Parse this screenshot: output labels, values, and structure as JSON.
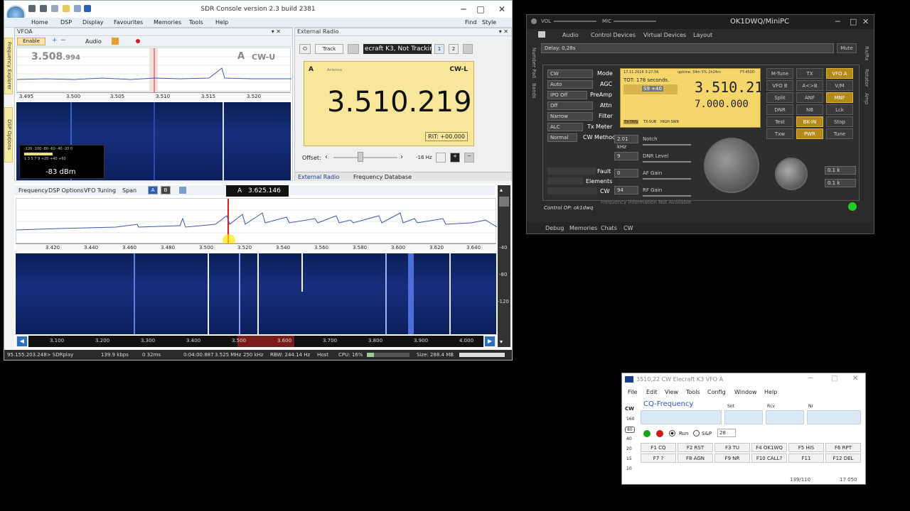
{
  "sdr": {
    "title": "SDR Console version 2.3 build 2381",
    "menu": [
      "Home",
      "DSP",
      "Display",
      "Favourites",
      "Memories",
      "Tools",
      "Help"
    ],
    "menu_right": [
      "Find",
      "Style"
    ],
    "vfo_title": "VFOA",
    "enable": "Enable",
    "audio": "Audio",
    "vfo_freq_main": "3.508",
    "vfo_freq_sub": ".994",
    "vfo_letter": "A",
    "vfo_mode": "CW-U",
    "top_ticks": [
      "3.495",
      "3.500",
      "3.505",
      "3.510",
      "3.515",
      "3.520"
    ],
    "smeter_ticks": "-120 -100 -80 -60 -40 -20 0",
    "smeter_scale": "1  3  5  7  9  +20 +40 +60",
    "smeter_value": "-83 dBm",
    "side_tab_1": "Frequency Explorer",
    "side_tab_2": "DSP Options",
    "ext_title": "External Radio",
    "track": "Track",
    "radio_name": "ecraft K3, Not Trackin",
    "page1": "1",
    "page2": "2",
    "ext_vfo": "A",
    "ext_antenna": "Antenna",
    "ext_mode": "CW-L",
    "ext_freq": "3.510.219",
    "rit": "RIT: +00.000",
    "offset_label": "Offset:",
    "offset_value": "-16 Hz",
    "tab_ext": "External Radio",
    "tab_db": "Frequency Database",
    "lower_menu": [
      "Frequency",
      "DSP Options",
      "VFO Tuning",
      "Span"
    ],
    "vfo_a_btn": "A",
    "vfo_b_btn": "B",
    "vfo_badge_letter": "A",
    "vfo_badge_freq": "3.625.146",
    "main_ticks": [
      "3.420",
      "3.440",
      "3.460",
      "3.480",
      "3.500",
      "3.520",
      "3.540",
      "3.560",
      "3.580",
      "3.600",
      "3.620",
      "3.640"
    ],
    "db_scale": [
      "-40",
      "-80",
      "-120"
    ],
    "bottom_ticks": [
      "3.100",
      "3.200",
      "3.300",
      "3.400",
      "3.500",
      "3.600",
      "3.700",
      "3.800",
      "3.900",
      "4.000"
    ],
    "status": [
      "95.155.203.248> SDRplay",
      "139.9 kbps",
      "0  32ms",
      "0:04:00.887",
      "3.525 MHz",
      "250 kHz",
      "RBW: 244.14 Hz",
      "Host",
      "CPU: 16%",
      "Size: 288.4 MB"
    ]
  },
  "ok": {
    "vol": "VOL",
    "mic": "MIC",
    "title": "OK1DWQ/MiniPC",
    "menu": [
      "Audio",
      "Control Devices",
      "Virtual Devices",
      "Layout"
    ],
    "delay": "Delay: 0,28s",
    "mute": "Mute",
    "left_tabs": [
      "Number Pad",
      "Bands"
    ],
    "right_tabs": [
      "Rx/Rx",
      "Rotator",
      "Amp"
    ],
    "controls": [
      {
        "value": "CW",
        "label": "Mode"
      },
      {
        "value": "Auto",
        "label": "AGC"
      },
      {
        "value": "IPO Off",
        "label": "PreAmp"
      },
      {
        "value": "Off",
        "label": "Attn"
      },
      {
        "value": "Narrow",
        "label": "Filter"
      },
      {
        "value": "ALC",
        "label": "Tx Meter"
      },
      {
        "value": "Normal",
        "label": "CW Method"
      }
    ],
    "lcd_date": "17.11.2016 3:27:56",
    "lcd_uptime": "uptime: 34m 5% 2h24m",
    "lcd_model": "FT-450D",
    "lcd_tot": "TOT: 178 seconds.",
    "lcd_smeter": "S9 +40",
    "lcd_freq_a": "3.510.219",
    "lcd_freq_b": "7.000.000",
    "lcd_flags": [
      "TX-TRIG",
      "TX-SUB",
      "HIGH SWR"
    ],
    "sliders": [
      {
        "value": "2.01 kHz",
        "label": "Notch"
      },
      {
        "value": "9",
        "label": "DNR Level"
      },
      {
        "value": "0",
        "label": "AF Gain"
      },
      {
        "value": "94",
        "label": "RF Gain"
      }
    ],
    "status_labels": [
      "Fault",
      "Elements",
      "CW"
    ],
    "buttons": [
      {
        "label": "M-Tune",
        "on": false
      },
      {
        "label": "TX",
        "on": false
      },
      {
        "label": "VFO A",
        "on": true
      },
      {
        "label": "VFO B",
        "on": false
      },
      {
        "label": "A<>B",
        "on": false
      },
      {
        "label": "V/M",
        "on": false
      },
      {
        "label": "Split",
        "on": false
      },
      {
        "label": "ANF",
        "on": false
      },
      {
        "label": "MNF",
        "on": true
      },
      {
        "label": "DNR",
        "on": false
      },
      {
        "label": "NB",
        "on": false
      },
      {
        "label": "Lck",
        "on": false
      },
      {
        "label": "Test",
        "on": false
      },
      {
        "label": "BK-IN",
        "on": true
      },
      {
        "label": "Stop",
        "on": false
      },
      {
        "label": "Txw",
        "on": false
      },
      {
        "label": "PWR",
        "on": true
      },
      {
        "label": "Tune",
        "on": false
      }
    ],
    "step1": "0.1 k",
    "step2": "0.1 k",
    "control_op": "Control OP: ok1dwq",
    "freq_info": "Frequency Information Not Available",
    "bottom_tabs": [
      "Debug",
      "Memories",
      "Chats",
      "CW"
    ],
    "led_color": "#22cc22"
  },
  "n1mm": {
    "title": "3510,22 CW Elecraft K3 VFO A",
    "menu": [
      "File",
      "Edit",
      "View",
      "Tools",
      "Config",
      "Window",
      "Help"
    ],
    "mode": "CW",
    "bands": [
      "160",
      "80",
      "40",
      "20",
      "15",
      "10"
    ],
    "cq_label": "CQ-Frequency",
    "snt": "Snt",
    "rcv": "Rcv",
    "nr": "Nr",
    "run": "Run",
    "sp": "S&P",
    "speed": "28",
    "fkeys": [
      "F1 CQ",
      "F2 RST",
      "F3 TU",
      "F4 OK1WQ",
      "F5 HIS",
      "F6 RPT",
      "F7 ?",
      "F8 AGN",
      "F9 NR",
      "F10 CALL?",
      "F11",
      "F12 DEL"
    ],
    "footer_left": "139/110",
    "footer_right": "17 050"
  }
}
